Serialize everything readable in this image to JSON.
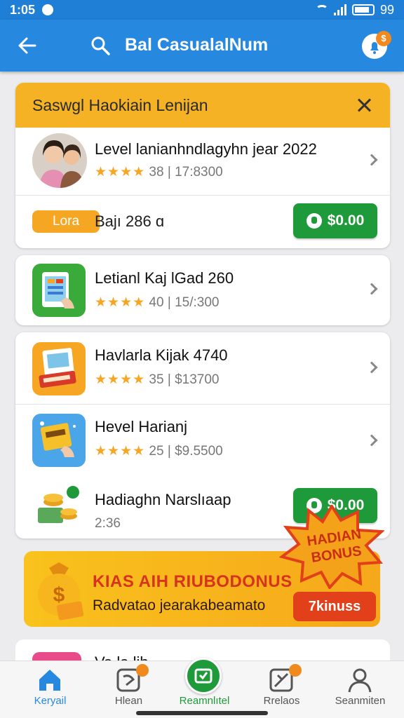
{
  "status_bar": {
    "time": "1:05",
    "battery": "99"
  },
  "app_bar": {
    "title": "Bal CasualalNum"
  },
  "featured_card": {
    "header_title": "Saswgl Haokiain Lenijan",
    "item": {
      "title": "Level lanianhndlagyhn jear 2022",
      "rating": "38",
      "value": "17:8300"
    },
    "promo": {
      "pill_label": "Lora",
      "text": "Bajı 286 ɑ",
      "button_label": "$0.00"
    }
  },
  "list_items": [
    {
      "title": "Letianl Kaj lGad 260",
      "rating": "40",
      "value": "15/:300"
    },
    {
      "title": "Havlarla Kijak 4740",
      "rating": "35",
      "value": "$13700"
    },
    {
      "title": "Hevel Harianj",
      "rating": "25",
      "value": "$9.5500"
    },
    {
      "title": "Hadiaghn Narslıaap",
      "sub": "2:36",
      "button_label": "$0.00"
    }
  ],
  "bonus": {
    "burst_text": "HADIAN BONUS",
    "title": "KIAS AIH RIUBODONUS",
    "subtitle": "Radvatao jearakabeamato",
    "button_label": "7kinuss"
  },
  "partial_item": {
    "title": "Va la lib"
  },
  "bottom_nav": [
    {
      "label": "Keryail"
    },
    {
      "label": "Hlean"
    },
    {
      "label": "Reamnlıtel"
    },
    {
      "label": "Rrelaos"
    },
    {
      "label": "Seanmiten"
    }
  ],
  "colors": {
    "primary": "#2788df",
    "accent": "#f5b224",
    "success": "#1f9a3a",
    "danger": "#e2401b"
  }
}
